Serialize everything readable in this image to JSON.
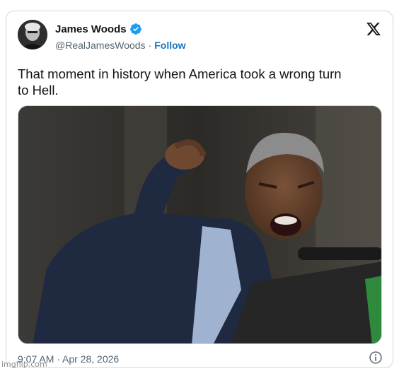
{
  "author": {
    "display_name": "James Woods",
    "handle": "@RealJamesWoods",
    "separator": "·",
    "follow_label": "Follow",
    "verified": true
  },
  "tweet": {
    "text": "That moment in history when America took a wrong turn\nto Hell.",
    "timestamp": "9:07 AM · Apr 28, 2026"
  },
  "icons": {
    "platform_logo": "x-logo-icon",
    "verified_badge": "verified-badge-icon",
    "info": "info-icon"
  },
  "watermark": "imgflip.com",
  "colors": {
    "link": "#1d72c2",
    "verified": "#1d9bf0",
    "secondary_text": "#536471",
    "primary_text": "#0f1419",
    "border": "#cfd9de"
  }
}
